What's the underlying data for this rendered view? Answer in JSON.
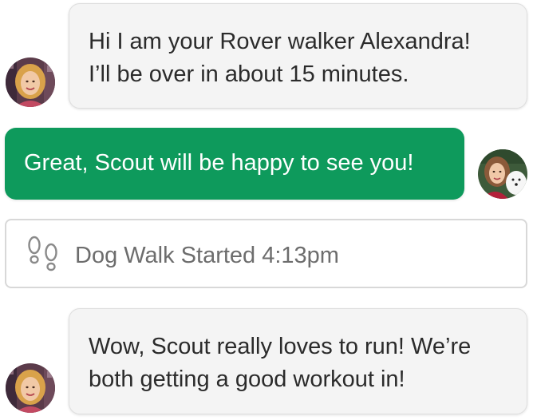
{
  "messages": [
    {
      "from": "walker",
      "lines": [
        "Hi I am your Rover walker Alexandra!",
        "I’ll be over in about 15 minutes."
      ]
    },
    {
      "from": "owner",
      "lines": [
        "Great, Scout will be happy to see you!"
      ]
    },
    {
      "from": "walker",
      "lines": [
        "Wow, Scout really loves to run! We’re",
        "both getting a good workout in!"
      ]
    }
  ],
  "event": {
    "icon": "footprints-icon",
    "text": "Dog Walk Started 4:13pm"
  },
  "colors": {
    "outgoing_bubble": "#0e9a5c",
    "incoming_bubble": "#f4f4f4",
    "event_text": "#6d6d6d"
  }
}
